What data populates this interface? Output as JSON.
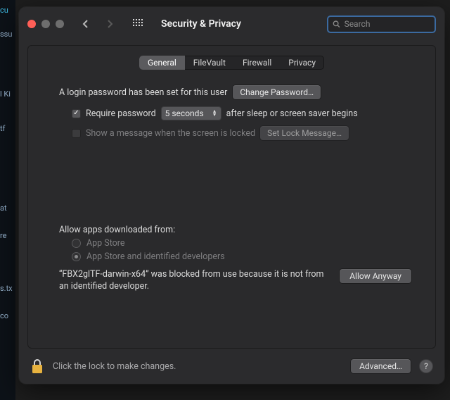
{
  "backdrop": [
    "cu",
    "ssu",
    "l Ki",
    "tf",
    "at",
    "re",
    "s.tx",
    "co"
  ],
  "toolbar": {
    "title": "Security & Privacy",
    "search_placeholder": "Search"
  },
  "tabs": [
    "General",
    "FileVault",
    "Firewall",
    "Privacy"
  ],
  "tabs_selected_index": 0,
  "general": {
    "login_pw_text": "A login password has been set for this user",
    "change_password_btn": "Change Password…",
    "require_pw_label": "Require password",
    "require_pw_delay": "5 seconds",
    "require_pw_suffix": "after sleep or screen saver begins",
    "show_msg_label": "Show a message when the screen is locked",
    "set_lock_msg_btn": "Set Lock Message…"
  },
  "allow": {
    "heading": "Allow apps downloaded from:",
    "opt1": "App Store",
    "opt2": "App Store and identified developers",
    "selected_index": 1,
    "blocked_text": "“FBX2glTF-darwin-x64” was blocked from use because it is not from an identified developer.",
    "allow_anyway_btn": "Allow Anyway"
  },
  "footer": {
    "lock_text": "Click the lock to make changes.",
    "advanced_btn": "Advanced…",
    "help": "?"
  }
}
